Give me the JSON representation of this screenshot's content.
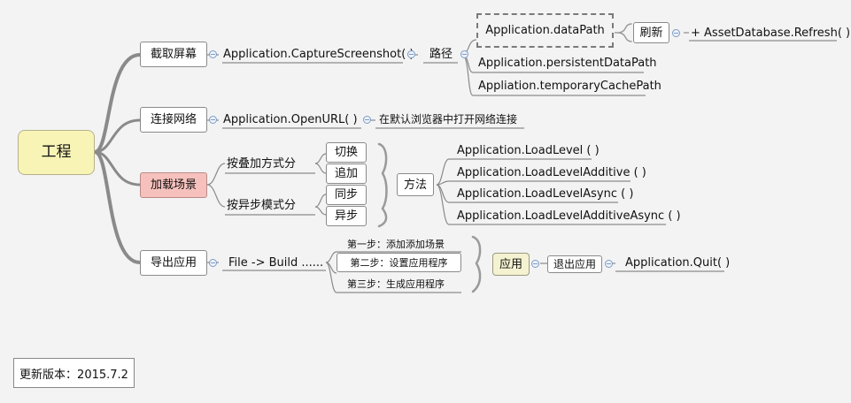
{
  "root": "工程",
  "branches": {
    "screenshot": {
      "title": "截取屏幕",
      "method": "Application.CaptureScreenshot( )",
      "path_label": "路径",
      "paths": [
        "Application.dataPath",
        "Application.persistentDataPath",
        "Appliation.temporaryCachePath"
      ],
      "refresh_label": "刷新",
      "refresh_call": "+ AssetDatabase.Refresh( )"
    },
    "network": {
      "title": "连接网络",
      "method": "Application.OpenURL( )",
      "note": "在默认浏览器中打开网络连接"
    },
    "scene": {
      "title": "加载场景",
      "by_stack": "按叠加方式分",
      "stack_modes": [
        "切换",
        "追加"
      ],
      "by_async": "按异步模式分",
      "async_modes": [
        "同步",
        "异步"
      ],
      "methods_label": "方法",
      "methods": [
        "Application.LoadLevel ( )",
        "Application.LoadLevelAdditive ( )",
        "Application.LoadLevelAsync ( )",
        "Application.LoadLevelAdditiveAsync ( )"
      ]
    },
    "export": {
      "title": "导出应用",
      "build": "File ->  Build ......",
      "steps": [
        "第一步：添加添加场景",
        "第二步：设置应用程序",
        "第三步：生成应用程序"
      ],
      "app_label": "应用",
      "quit_label": "退出应用",
      "quit_call": "Application.Quit( )"
    }
  },
  "version_note": "更新版本：2015.7.2",
  "colors": {
    "root_fill": "#f8f4b6",
    "highlight_fill": "#f6c1bd",
    "app_fill": "#f4f2d0",
    "line": "#808080"
  }
}
